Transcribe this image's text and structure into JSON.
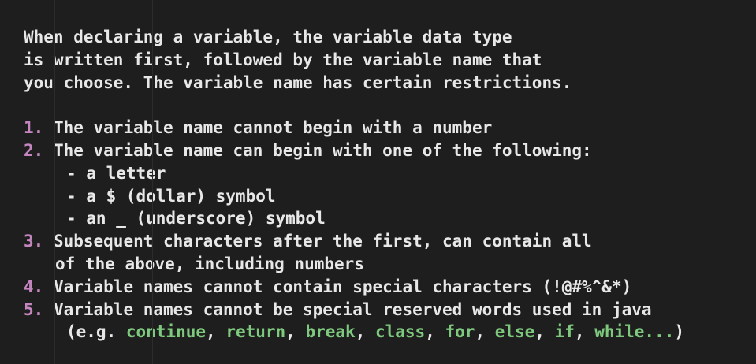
{
  "intro": [
    "When declaring a variable, the variable data type",
    "is written first, followed by the variable name that",
    "you choose. The variable name has certain restrictions."
  ],
  "rules": [
    {
      "num": "1.",
      "text": " The variable name cannot begin with a number"
    },
    {
      "num": "2.",
      "text": " The variable name can begin with one of the following:"
    },
    {
      "num": "3.",
      "text": " Subsequent characters after the first, can contain all"
    },
    {
      "num": "4.",
      "text": " Variable names cannot contain special characters (!@#%^&*)"
    },
    {
      "num": "5.",
      "text": " Variable names cannot be special reserved words used in java"
    }
  ],
  "sub_items": [
    "- a letter",
    "- a $ (dollar) symbol",
    "- an _ (underscore) symbol"
  ],
  "rule3_continuation": "of the above, including numbers",
  "reserved": {
    "prefix": "(e.g. ",
    "words": [
      "continue",
      "return",
      "break",
      "class",
      "for",
      "else",
      "if",
      "while..."
    ],
    "separator": ", ",
    "suffix": ")"
  },
  "colors": {
    "background": "#1e1e1e",
    "text": "#e8e8e8",
    "list_number": "#c586c0",
    "keyword": "#7ec97e"
  }
}
